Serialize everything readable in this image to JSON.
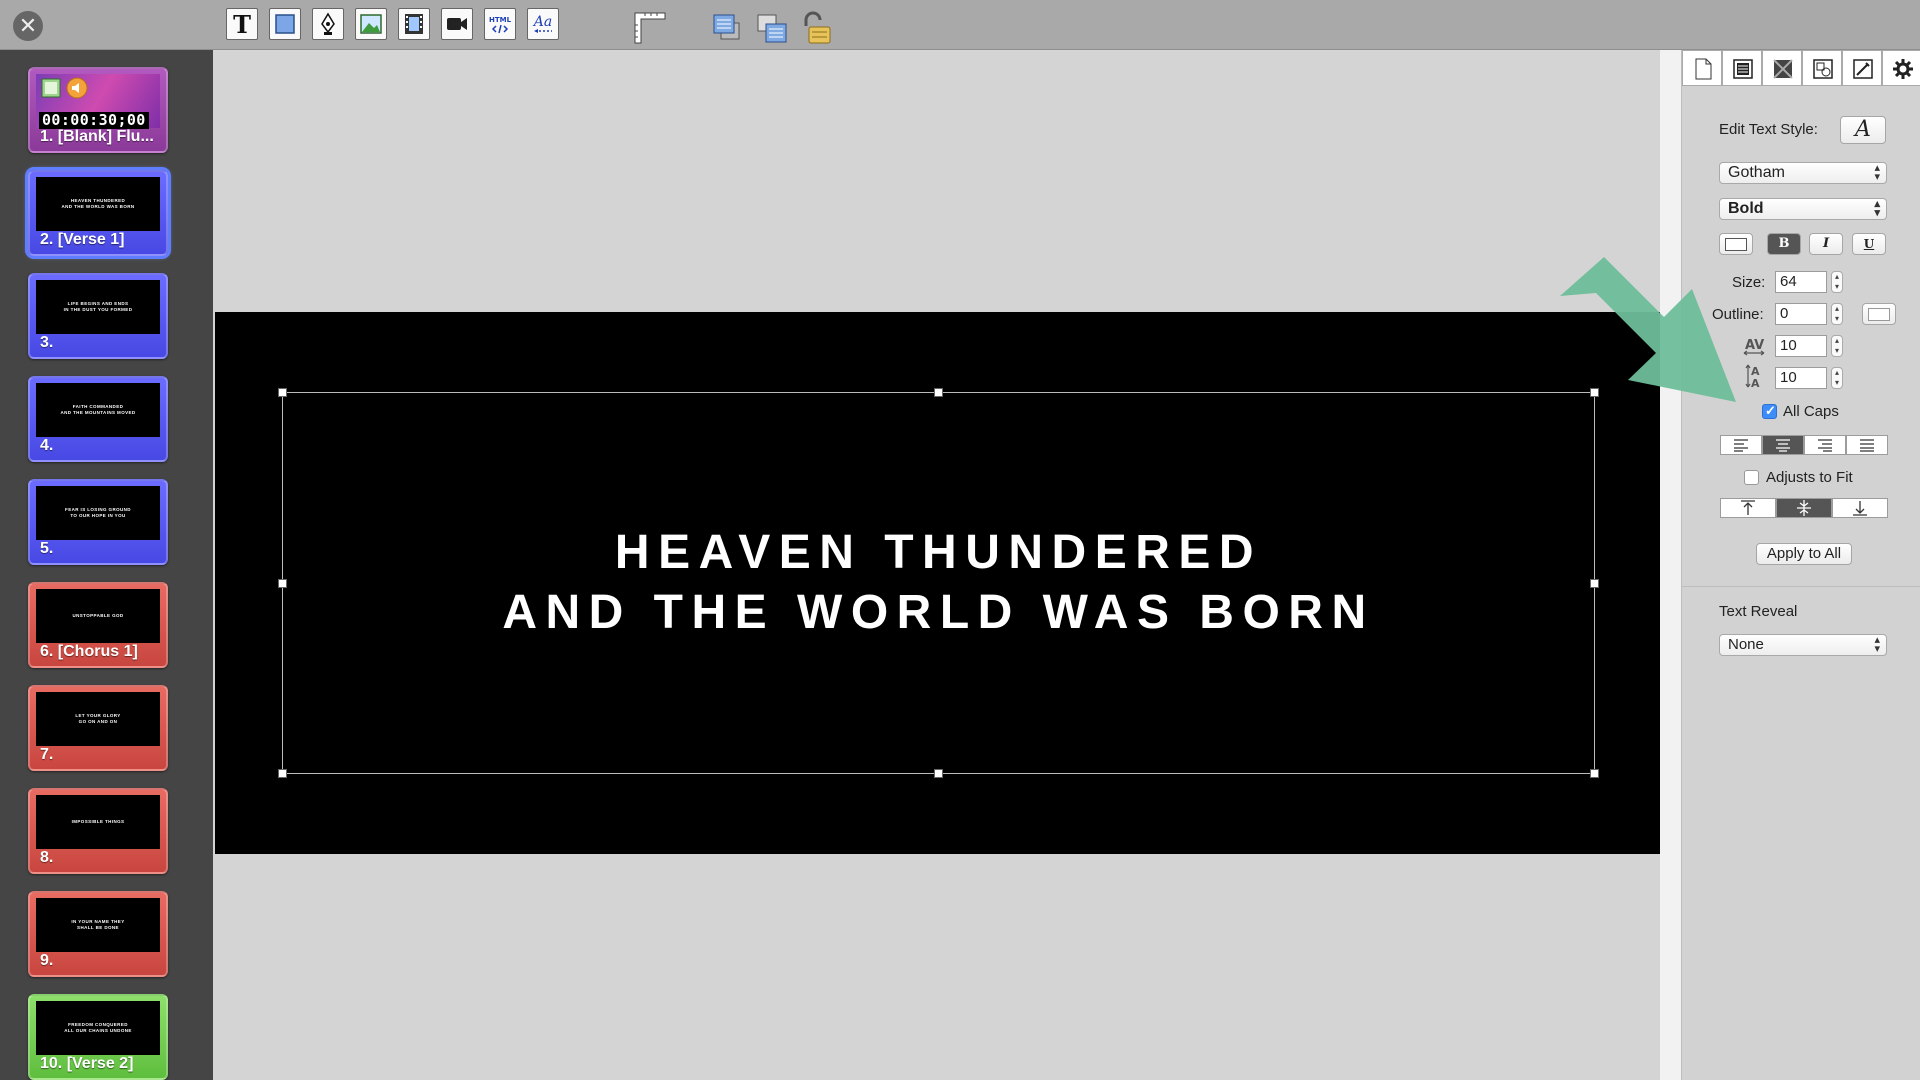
{
  "toolbar": {
    "close_icon": "close-icon",
    "tools": [
      "text-tool-icon",
      "shape-tool-icon",
      "pen-tool-icon",
      "image-tool-icon",
      "video-tool-icon",
      "live-video-tool-icon",
      "html-tool-icon",
      "ticker-tool-icon",
      "ruler-icon",
      "bring-forward-icon",
      "send-backward-icon",
      "lock-icon"
    ],
    "text_tool_glyph": "T",
    "html_tool_glyph": "HTML",
    "ticker_tool_glyph": "Aa"
  },
  "slides": [
    {
      "label": "1. [Blank] Flu...",
      "thumb": "",
      "timecode": "00:00:30;00",
      "color": "purple"
    },
    {
      "label": "2. [Verse 1]",
      "thumb": "HEAVEN THUNDERED\nAND THE WORLD WAS BORN",
      "color": "blue",
      "selected": true
    },
    {
      "label": "3.",
      "thumb": "LIFE BEGINS AND ENDS\nIN THE DUST YOU FORMED",
      "color": "blue"
    },
    {
      "label": "4.",
      "thumb": "FAITH COMMANDED\nAND THE MOUNTAINS MOVED",
      "color": "blue"
    },
    {
      "label": "5.",
      "thumb": "FEAR IS LOSING GROUND\nTO OUR HOPE IN YOU",
      "color": "blue"
    },
    {
      "label": "6. [Chorus 1]",
      "thumb": "UNSTOPPABLE GOD",
      "color": "red"
    },
    {
      "label": "7.",
      "thumb": "LET YOUR GLORY\nGO ON AND ON",
      "color": "red"
    },
    {
      "label": "8.",
      "thumb": "IMPOSSIBLE THINGS",
      "color": "red"
    },
    {
      "label": "9.",
      "thumb": "IN YOUR NAME THEY\nSHALL BE DONE",
      "color": "red"
    },
    {
      "label": "10. [Verse 2]",
      "thumb": "FREEDOM CONQUERED\nALL OUR CHAINS UNDONE",
      "color": "green"
    }
  ],
  "canvas": {
    "line1": "HEAVEN THUNDERED",
    "line2": "AND THE WORLD WAS BORN"
  },
  "inspector": {
    "tabs": [
      "page-icon",
      "layout-icon",
      "background-icon",
      "shapes-icon",
      "edit-icon",
      "gear-icon"
    ],
    "edit_text_style_label": "Edit Text Style:",
    "text_style_glyph": "A",
    "font_family": "Gotham",
    "font_weight": "Bold",
    "bold_glyph": "B",
    "italic_glyph": "I",
    "underline_glyph": "U",
    "size_label": "Size:",
    "size_value": "64",
    "outline_label": "Outline:",
    "outline_value": "0",
    "kerning_value": "10",
    "line_spacing_value": "10",
    "all_caps_label": "All Caps",
    "all_caps_checked": true,
    "adjusts_to_fit_label": "Adjusts to Fit",
    "adjusts_to_fit_checked": false,
    "apply_to_all_label": "Apply to All",
    "text_reveal_label": "Text Reveal",
    "text_reveal_value": "None"
  },
  "colors": {
    "annotation_arrow": "#6ebd9a",
    "selection": "#5f7dff"
  }
}
